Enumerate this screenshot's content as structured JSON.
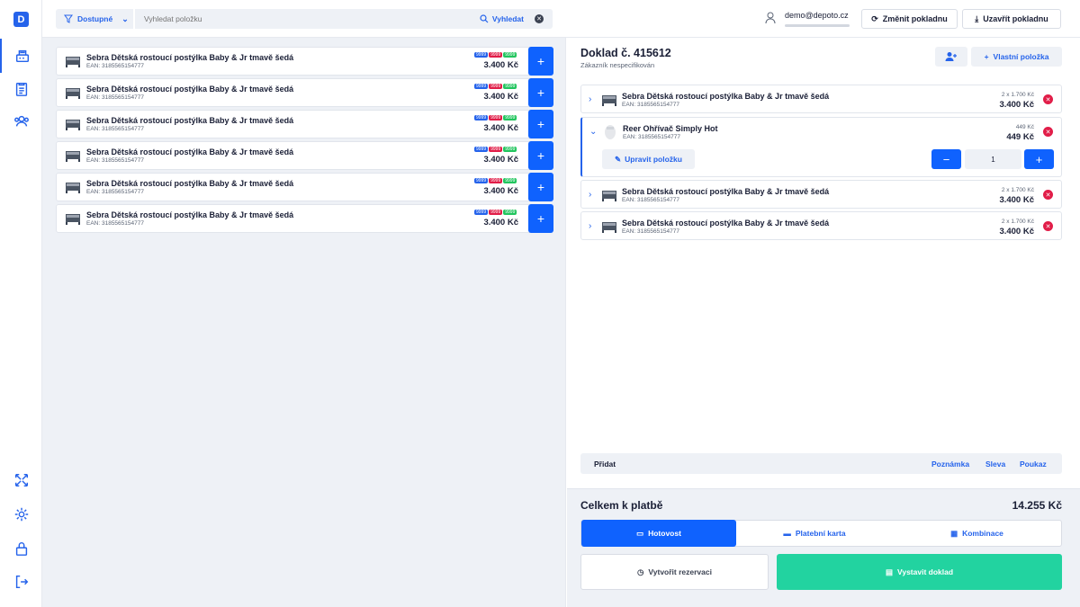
{
  "rail": {
    "logo": "D",
    "icons": [
      "cash-register-icon",
      "document-list-icon",
      "users-icon",
      "fullscreen-icon",
      "gear-icon",
      "lock-icon",
      "logout-icon"
    ]
  },
  "topbar": {
    "filter_label": "Dostupné",
    "search_placeholder": "Vyhledat položku",
    "search_button": "Vyhledat",
    "user_email": "demo@depoto.cz",
    "change_register": "Změnit pokladnu",
    "close_register": "Uzavřít pokladnu"
  },
  "products": [
    {
      "name": "Sebra Dětská rostoucí postýlka Baby & Jr tmavě šedá",
      "ean": "EAN: 3185565154777",
      "tags": [
        "9999",
        "9999",
        "9999"
      ],
      "price": "3.400 Kč"
    },
    {
      "name": "Sebra Dětská rostoucí postýlka Baby & Jr tmavě šedá",
      "ean": "EAN: 3185565154777",
      "tags": [
        "9999",
        "9999",
        "9999"
      ],
      "price": "3.400 Kč"
    },
    {
      "name": "Sebra Dětská rostoucí postýlka Baby & Jr tmavě šedá",
      "ean": "EAN: 3185565154777",
      "tags": [
        "9999",
        "9999",
        "9999"
      ],
      "price": "3.400 Kč"
    },
    {
      "name": "Sebra Dětská rostoucí postýlka Baby & Jr tmavě šedá",
      "ean": "EAN: 3185565154777",
      "tags": [
        "9999",
        "9999",
        "9999"
      ],
      "price": "3.400 Kč"
    },
    {
      "name": "Sebra Dětská rostoucí postýlka Baby & Jr tmavě šedá",
      "ean": "EAN: 3185565154777",
      "tags": [
        "9999",
        "9999",
        "9999"
      ],
      "price": "3.400 Kč"
    },
    {
      "name": "Sebra Dětská rostoucí postýlka Baby & Jr tmavě šedá",
      "ean": "EAN: 3185565154777",
      "tags": [
        "9999",
        "9999",
        "9999"
      ],
      "price": "3.400 Kč"
    }
  ],
  "tag_colors": [
    "#2563eb",
    "#e11d48",
    "#22c55e"
  ],
  "receipt": {
    "title": "Doklad č. 415612",
    "customer": "Zákazník nespecifikován",
    "custom_item": "Vlastní položka",
    "lines": [
      {
        "name": "Sebra Dětská rostoucí postýlka Baby & Jr tmavě šedá",
        "ean": "EAN: 3185565154777",
        "unit": "2 x 1.700 Kč",
        "total": "3.400 Kč"
      },
      {
        "name": "Reer Ohřívač Simply Hot",
        "ean": "EAN: 3185565154777",
        "unit": "449 Kč",
        "total": "449 Kč",
        "edit_label": "Upravit položku",
        "qty": "1"
      },
      {
        "name": "Sebra Dětská rostoucí postýlka Baby & Jr tmavě šedá",
        "ean": "EAN: 3185565154777",
        "unit": "2 x 1.700 Kč",
        "total": "3.400 Kč"
      },
      {
        "name": "Sebra Dětská rostoucí postýlka Baby & Jr tmavě šedá",
        "ean": "EAN: 3185565154777",
        "unit": "2 x 1.700 Kč",
        "total": "3.400 Kč"
      }
    ],
    "add_label": "Přidat",
    "add_links": [
      "Poznámka",
      "Sleva",
      "Poukaz"
    ],
    "total_label": "Celkem k platbě",
    "total_amount": "14.255 Kč",
    "payment": [
      "Hotovost",
      "Platební karta",
      "Kombinace"
    ],
    "reserve": "Vytvořit rezervaci",
    "issue": "Vystavit doklad"
  }
}
